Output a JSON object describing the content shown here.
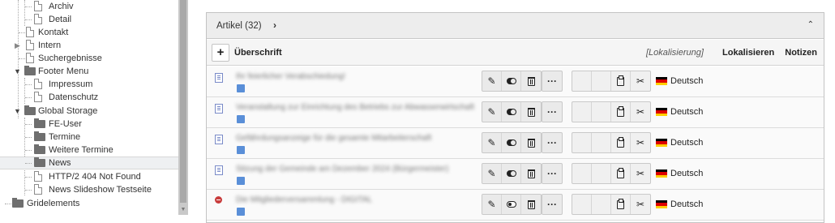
{
  "tree": {
    "items": [
      {
        "label": "Archiv",
        "type": "page",
        "level": 2
      },
      {
        "label": "Detail",
        "type": "page",
        "level": 2
      },
      {
        "label": "Kontakt",
        "type": "page",
        "level": 1
      },
      {
        "label": "Intern",
        "type": "page",
        "level": 1,
        "toggle": "closed"
      },
      {
        "label": "Suchergebnisse",
        "type": "page",
        "level": 1
      },
      {
        "label": "Footer Menu",
        "type": "folder",
        "level": 1,
        "toggle": "open"
      },
      {
        "label": "Impressum",
        "type": "page",
        "level": 2
      },
      {
        "label": "Datenschutz",
        "type": "page",
        "level": 2
      },
      {
        "label": "Global Storage",
        "type": "folder",
        "level": 1,
        "toggle": "open"
      },
      {
        "label": "FE-User",
        "type": "folder",
        "level": 2
      },
      {
        "label": "Termine",
        "type": "folder",
        "level": 2
      },
      {
        "label": "Weitere Termine",
        "type": "folder",
        "level": 2
      },
      {
        "label": "News",
        "type": "folder",
        "level": 2,
        "selected": true
      },
      {
        "label": "HTTP/2 404 Not Found",
        "type": "page",
        "level": 2
      },
      {
        "label": "News Slideshow Testseite",
        "type": "page",
        "level": 2
      },
      {
        "label": "Gridelements",
        "type": "folder",
        "level": 0
      }
    ]
  },
  "panel": {
    "title": "Artikel (32)",
    "title_chevron": "›",
    "collapse_icon": "⌃",
    "add_label": "+",
    "column_title": "Überschrift",
    "localization_link": "[Lokalisierung]",
    "localize_button": "Lokalisieren",
    "notes_button": "Notizen"
  },
  "rows": [
    {
      "title": "Ihr feierlicher Verabschiedung!",
      "language": "Deutsch",
      "hidden": false
    },
    {
      "title": "Veranstaltung zur Einrichtung des Betriebs zur Abwasserwirtschaft",
      "language": "Deutsch",
      "hidden": false
    },
    {
      "title": "Gefährdungsanzeige für die gesamte Mitarbeiterschaft",
      "language": "Deutsch",
      "hidden": false
    },
    {
      "title": "Sitzung der Gemeinde am Dezember 2024 (Bürgermeister)",
      "language": "Deutsch",
      "hidden": false
    },
    {
      "title": "Die Mitgliederversammlung - DIGITAL",
      "language": "Deutsch",
      "hidden": true
    }
  ],
  "colors": {
    "flag_black": "#000000",
    "flag_red": "#dd0000",
    "flag_gold": "#ffce00",
    "hidden_badge": "#c83c3c",
    "record_icon": "#7a8bc8"
  }
}
